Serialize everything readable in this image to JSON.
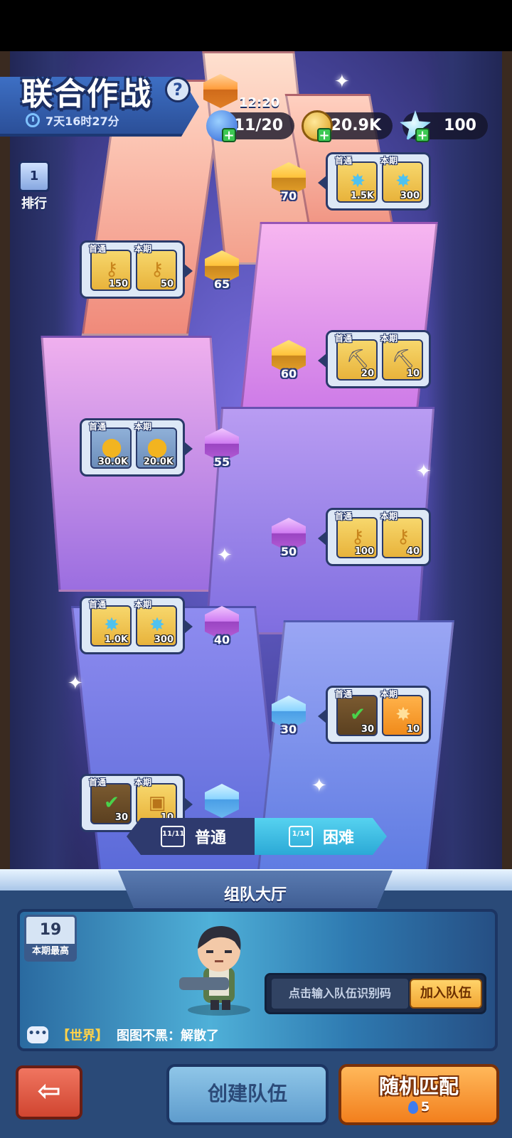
{
  "header": {
    "title": "联合作战",
    "help_icon_text": "?",
    "timer": "7天16时27分",
    "rank": {
      "badge": "1",
      "label": "排行"
    }
  },
  "resources": {
    "energy_timer": "12:20",
    "energy": "11/20",
    "coins": "20.9K",
    "crystals": "100"
  },
  "nodes": [
    {
      "level": "70",
      "color": "gold"
    },
    {
      "level": "65",
      "color": "gold"
    },
    {
      "level": "60",
      "color": "gold"
    },
    {
      "level": "55",
      "color": "purple"
    },
    {
      "level": "50",
      "color": "purple"
    },
    {
      "level": "40",
      "color": "purple"
    },
    {
      "level": "30",
      "color": "blue"
    }
  ],
  "rewards": [
    {
      "first_label": "首通",
      "period_label": "本期",
      "first_icon": "blue-crystal-icon",
      "first_count": "1.5K",
      "period_icon": "blue-crystal-icon",
      "period_count": "300"
    },
    {
      "first_label": "首通",
      "period_label": "本期",
      "first_icon": "gold-key-icon",
      "first_count": "150",
      "period_icon": "gold-key-icon",
      "period_count": "50"
    },
    {
      "first_label": "首通",
      "period_label": "本期",
      "first_icon": "pickaxe-icon",
      "first_count": "20",
      "period_icon": "pickaxe-icon",
      "period_count": "10"
    },
    {
      "first_label": "首通",
      "period_label": "本期",
      "first_icon": "gold-coin-icon",
      "first_count": "30.0K",
      "period_icon": "gold-coin-icon",
      "period_count": "20.0K"
    },
    {
      "first_label": "首通",
      "period_label": "本期",
      "first_icon": "gold-key-icon",
      "first_count": "100",
      "period_icon": "gold-key-icon",
      "period_count": "40"
    },
    {
      "first_label": "首通",
      "period_label": "本期",
      "first_icon": "blue-crystal-icon",
      "first_count": "1.0K",
      "period_icon": "blue-crystal-icon",
      "period_count": "300"
    },
    {
      "first_label": "首通",
      "period_label": "本期",
      "first_icon": "check-scroll-icon",
      "first_count": "30",
      "period_icon": "orange-crystal-icon",
      "period_count": "10"
    },
    {
      "first_label": "首通",
      "period_label": "本期",
      "first_icon": "check-scroll-icon",
      "first_count": "30",
      "period_icon": "treasure-chest-icon",
      "period_count": "10"
    }
  ],
  "difficulty": {
    "normal": {
      "label": "普通",
      "progress": "11/11"
    },
    "hard": {
      "label": "困难",
      "progress": "1/14"
    }
  },
  "lobby": {
    "title": "组队大厅",
    "best_value": "19",
    "best_label": "本期最高",
    "code_placeholder": "点击输入队伍识别码",
    "join_label": "加入队伍",
    "chat_channel": "【世界】",
    "chat_message": "图图不黑：解散了"
  },
  "buttons": {
    "back_icon": "⇦",
    "create_label": "创建队伍",
    "match_label": "随机匹配",
    "match_cost": "5"
  },
  "colors": {
    "accent_blue": "#2ba9d6",
    "accent_orange": "#f27f1d",
    "panel": "#2a4a78"
  }
}
